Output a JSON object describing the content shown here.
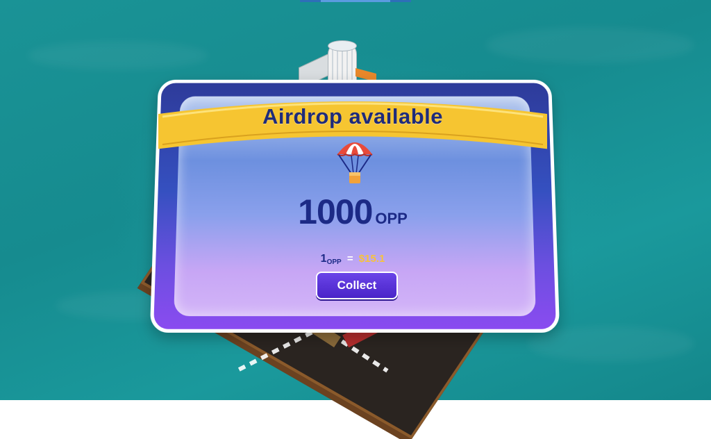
{
  "popup": {
    "title": "Airdrop available",
    "icon": "parachute-icon",
    "amount": "1000",
    "amount_unit": "OPP",
    "rate_one": "1",
    "rate_unit": "OPP",
    "rate_eq": "=",
    "rate_value": "$15.1",
    "collect_label": "Collect"
  },
  "colors": {
    "ribbon": "#f6c531",
    "title": "#1f2b7a",
    "button": "#5231d6",
    "price": "#f7c23a",
    "background": "#1a9396"
  }
}
